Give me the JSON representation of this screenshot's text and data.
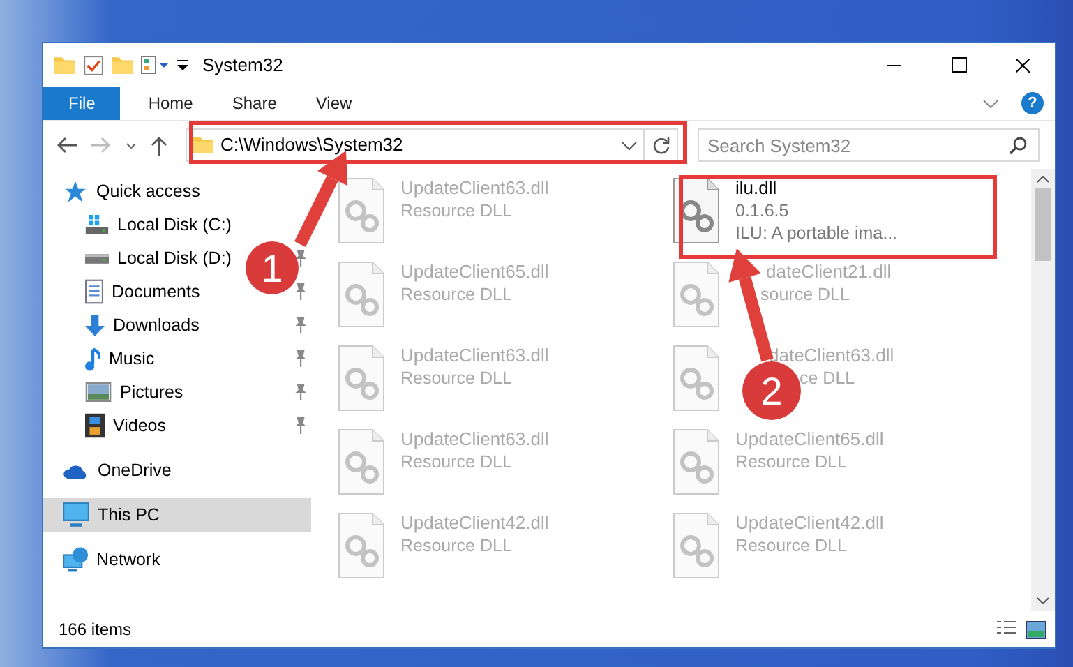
{
  "window": {
    "title": "System32"
  },
  "ribbon_tabs": [
    {
      "label": "File",
      "selected": true
    },
    {
      "label": "Home",
      "selected": false
    },
    {
      "label": "Share",
      "selected": false
    },
    {
      "label": "View",
      "selected": false
    }
  ],
  "help_glyph": "?",
  "address": {
    "path": "C:\\Windows\\System32"
  },
  "search": {
    "placeholder": "Search System32"
  },
  "nav": [
    {
      "label": "Quick access",
      "kind": "star",
      "pinned": false,
      "selected": false,
      "children": [
        {
          "label": "Local Disk (C:)",
          "kind": "windrive",
          "pinned": false,
          "selected": false
        },
        {
          "label": "Local Disk (D:)",
          "kind": "drive",
          "pinned": true,
          "selected": false
        },
        {
          "label": "Documents",
          "kind": "documents",
          "pinned": true,
          "selected": false
        },
        {
          "label": "Downloads",
          "kind": "downloads",
          "pinned": true,
          "selected": false
        },
        {
          "label": "Music",
          "kind": "music",
          "pinned": true,
          "selected": false
        },
        {
          "label": "Pictures",
          "kind": "pictures",
          "pinned": true,
          "selected": false
        },
        {
          "label": "Videos",
          "kind": "videos",
          "pinned": true,
          "selected": false
        }
      ]
    },
    {
      "label": "OneDrive",
      "kind": "cloud",
      "pinned": false,
      "selected": false
    },
    {
      "label": "This PC",
      "kind": "computer",
      "pinned": false,
      "selected": true
    },
    {
      "label": "Network",
      "kind": "network",
      "pinned": false,
      "selected": false
    }
  ],
  "files": [
    {
      "name": "UpdateClient63.dll",
      "detail": "Resource DLL",
      "dimmed": true
    },
    {
      "name": "ilu.dll",
      "version": "0.1.6.5",
      "detail": "ILU: A portable ima...",
      "dimmed": false
    },
    {
      "name": "UpdateClient65.dll",
      "detail": "Resource DLL",
      "dimmed": true
    },
    {
      "name": "dateClient21.dll",
      "detail": "source DLL",
      "dimmed": true
    },
    {
      "name": "UpdateClient63.dll",
      "detail": "Resource DLL",
      "dimmed": true
    },
    {
      "name": "dateClient63.dll",
      "detail": "ce DLL",
      "dimmed": true
    },
    {
      "name": "UpdateClient63.dll",
      "detail": "Resource DLL",
      "dimmed": true
    },
    {
      "name": "UpdateClient65.dll",
      "detail": "Resource DLL",
      "dimmed": true
    },
    {
      "name": "UpdateClient42.dll",
      "detail": "Resource DLL",
      "dimmed": true
    },
    {
      "name": "UpdateClient42.dll",
      "detail": "Resource DLL",
      "dimmed": true
    }
  ],
  "status_bar": {
    "count": "166 items"
  },
  "callouts": [
    {
      "number": "1"
    },
    {
      "number": "2"
    }
  ]
}
